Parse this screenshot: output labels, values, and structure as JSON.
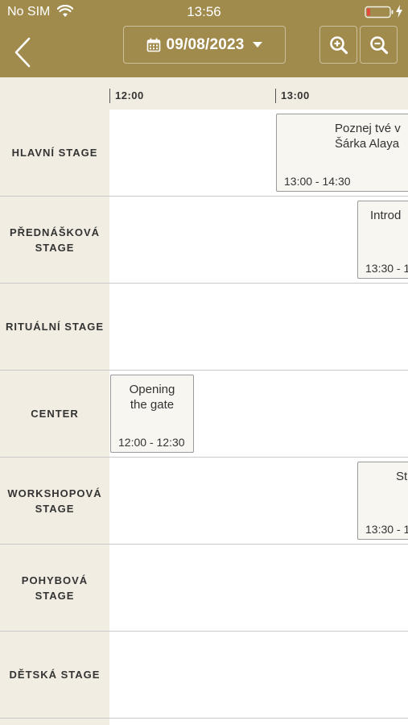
{
  "status_bar": {
    "carrier": "No SIM",
    "time": "13:56",
    "battery_color": "#e34b3c"
  },
  "nav": {
    "date": "09/08/2023",
    "back_icon": "chevron-left-icon",
    "calendar_icon": "calendar-icon",
    "zoom_in_icon": "zoom-in-icon",
    "zoom_out_icon": "zoom-out-icon"
  },
  "colors": {
    "brand": "#a08b4d",
    "stage_bg": "#f2ede2",
    "event_bg": "#f8f6f1"
  },
  "timeline": {
    "labels": [
      "12:00",
      "13:00"
    ]
  },
  "stages": [
    {
      "label": "HLAVNÍ STAGE"
    },
    {
      "label": "PŘEDNÁŠKOVÁ STAGE"
    },
    {
      "label": "RITUÁLNÍ STAGE"
    },
    {
      "label": "CENTER"
    },
    {
      "label": "WORKSHOPOVÁ STAGE"
    },
    {
      "label": "POHYBOVÁ STAGE"
    },
    {
      "label": "DĚTSKÁ STAGE"
    }
  ],
  "events": [
    {
      "title": "Poznej tvé v\nŠárka Alaya",
      "time": "13:00 - 14:30"
    },
    {
      "title": "Introd",
      "time": "13:30 - 1"
    },
    {
      "title": "Opening\nthe gate",
      "time": "12:00 - 12:30"
    },
    {
      "title": "St",
      "time": "13:30 - 1"
    }
  ]
}
